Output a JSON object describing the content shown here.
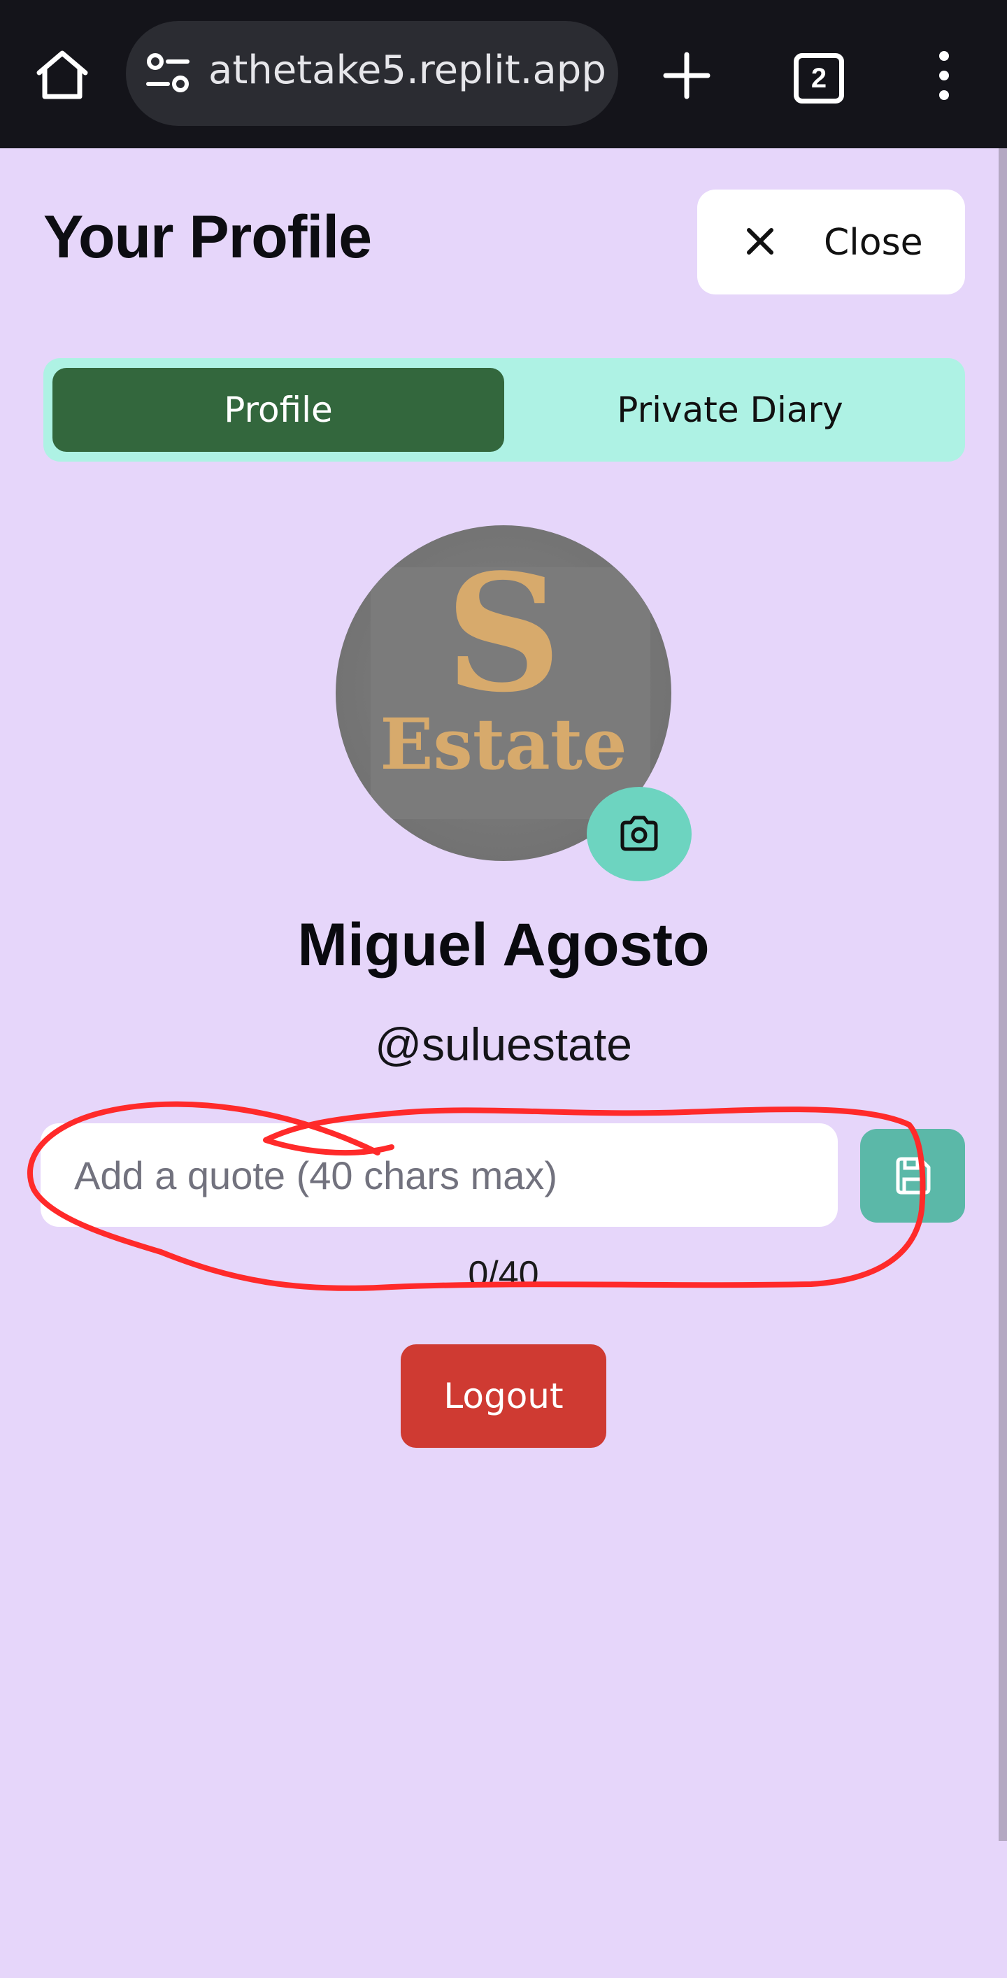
{
  "browser": {
    "url": "athetake5.replit.app",
    "tab_count": "2"
  },
  "header": {
    "title": "Your Profile",
    "close_label": "Close"
  },
  "tabs": [
    {
      "label": "Profile",
      "active": true
    },
    {
      "label": "Private Diary",
      "active": false
    }
  ],
  "profile": {
    "avatar_logo_letter": "S",
    "avatar_logo_word": "Estate",
    "display_name": "Miguel Agosto",
    "username": "@suluestate"
  },
  "quote": {
    "placeholder": "Add a quote (40 chars max)",
    "value": "",
    "char_count": "0/40"
  },
  "actions": {
    "logout_label": "Logout"
  },
  "colors": {
    "page_bg": "#e6d6fa",
    "tab_bar_bg": "#aef2e4",
    "active_tab": "#33673d",
    "camera_button": "#6dd4c0",
    "save_button": "#5bb8a8",
    "logout_button": "#cf3a32",
    "annotation": "#ff2a2a"
  },
  "icons": [
    "home-icon",
    "site-settings-icon",
    "plus-icon",
    "close-icon",
    "camera-icon",
    "save-icon",
    "more-vert-icon"
  ]
}
